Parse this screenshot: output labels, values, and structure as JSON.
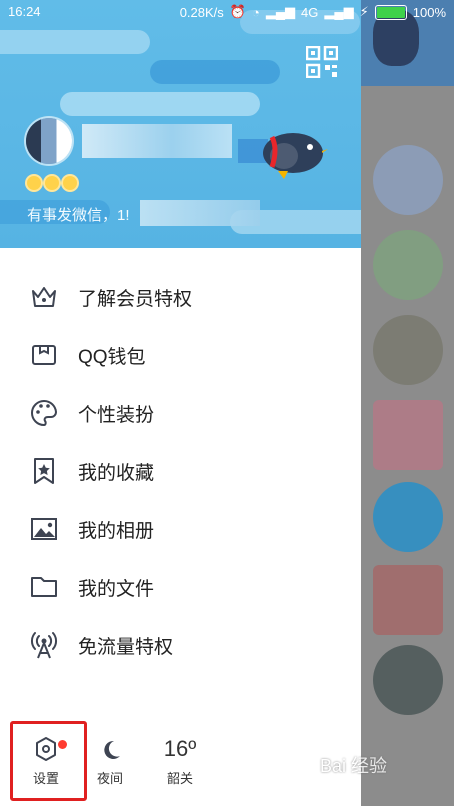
{
  "status_bar": {
    "time": "16:24",
    "network_speed": "0.28K/s",
    "network_type": "4G",
    "battery": "100%"
  },
  "profile": {
    "signature": "有事发微信，1!"
  },
  "menu": {
    "items": [
      {
        "label": "了解会员特权",
        "icon": "crown-icon"
      },
      {
        "label": "QQ钱包",
        "icon": "wallet-icon"
      },
      {
        "label": "个性装扮",
        "icon": "palette-icon"
      },
      {
        "label": "我的收藏",
        "icon": "bookmark-star-icon"
      },
      {
        "label": "我的相册",
        "icon": "picture-icon"
      },
      {
        "label": "我的文件",
        "icon": "folder-icon"
      },
      {
        "label": "免流量特权",
        "icon": "signal-tower-icon"
      }
    ]
  },
  "bottom_bar": {
    "settings_label": "设置",
    "night_label": "夜间",
    "temperature": "16º",
    "city": "韶关"
  },
  "watermark": "Bai 经验",
  "colors": {
    "header_blue": "#5ab6e5",
    "highlight_red": "#e02020",
    "icon_gray": "#3e4452"
  }
}
